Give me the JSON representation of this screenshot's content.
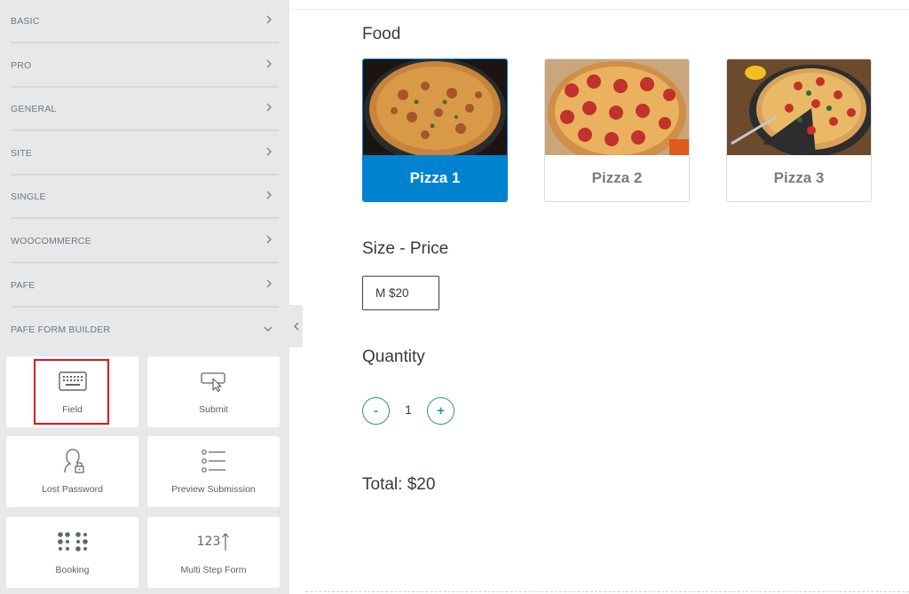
{
  "sidebar": {
    "categories": [
      {
        "label": "BASIC",
        "state": "collapsed"
      },
      {
        "label": "PRO",
        "state": "collapsed"
      },
      {
        "label": "GENERAL",
        "state": "collapsed"
      },
      {
        "label": "SITE",
        "state": "collapsed"
      },
      {
        "label": "SINGLE",
        "state": "collapsed"
      },
      {
        "label": "WOOCOMMERCE",
        "state": "collapsed"
      },
      {
        "label": "PAFE",
        "state": "collapsed"
      },
      {
        "label": "PAFE FORM BUILDER",
        "state": "expanded"
      }
    ],
    "widgets": [
      {
        "label": "Field",
        "icon": "keyboard-icon",
        "highlighted": true
      },
      {
        "label": "Submit",
        "icon": "cursor-click-icon"
      },
      {
        "label": "Lost Password",
        "icon": "user-lock-icon"
      },
      {
        "label": "Preview Submission",
        "icon": "list-icon"
      },
      {
        "label": "Booking",
        "icon": "dots-grid-icon"
      },
      {
        "label": "Multi Step Form",
        "icon": "numbers-icon"
      }
    ],
    "numbers_icon_text": "123"
  },
  "form": {
    "food": {
      "title": "Food",
      "options": [
        {
          "label": "Pizza 1",
          "selected": true
        },
        {
          "label": "Pizza 2",
          "selected": false
        },
        {
          "label": "Pizza 3",
          "selected": false
        }
      ]
    },
    "size": {
      "title": "Size - Price",
      "option": "M $20"
    },
    "quantity": {
      "title": "Quantity",
      "minus": "-",
      "value": "1",
      "plus": "+"
    },
    "total": "Total: $20"
  },
  "colors": {
    "accent": "#0083cf",
    "highlight": "#e2141a",
    "stepper": "#2f8f96",
    "sidebar_bg": "#e6e8ea"
  }
}
